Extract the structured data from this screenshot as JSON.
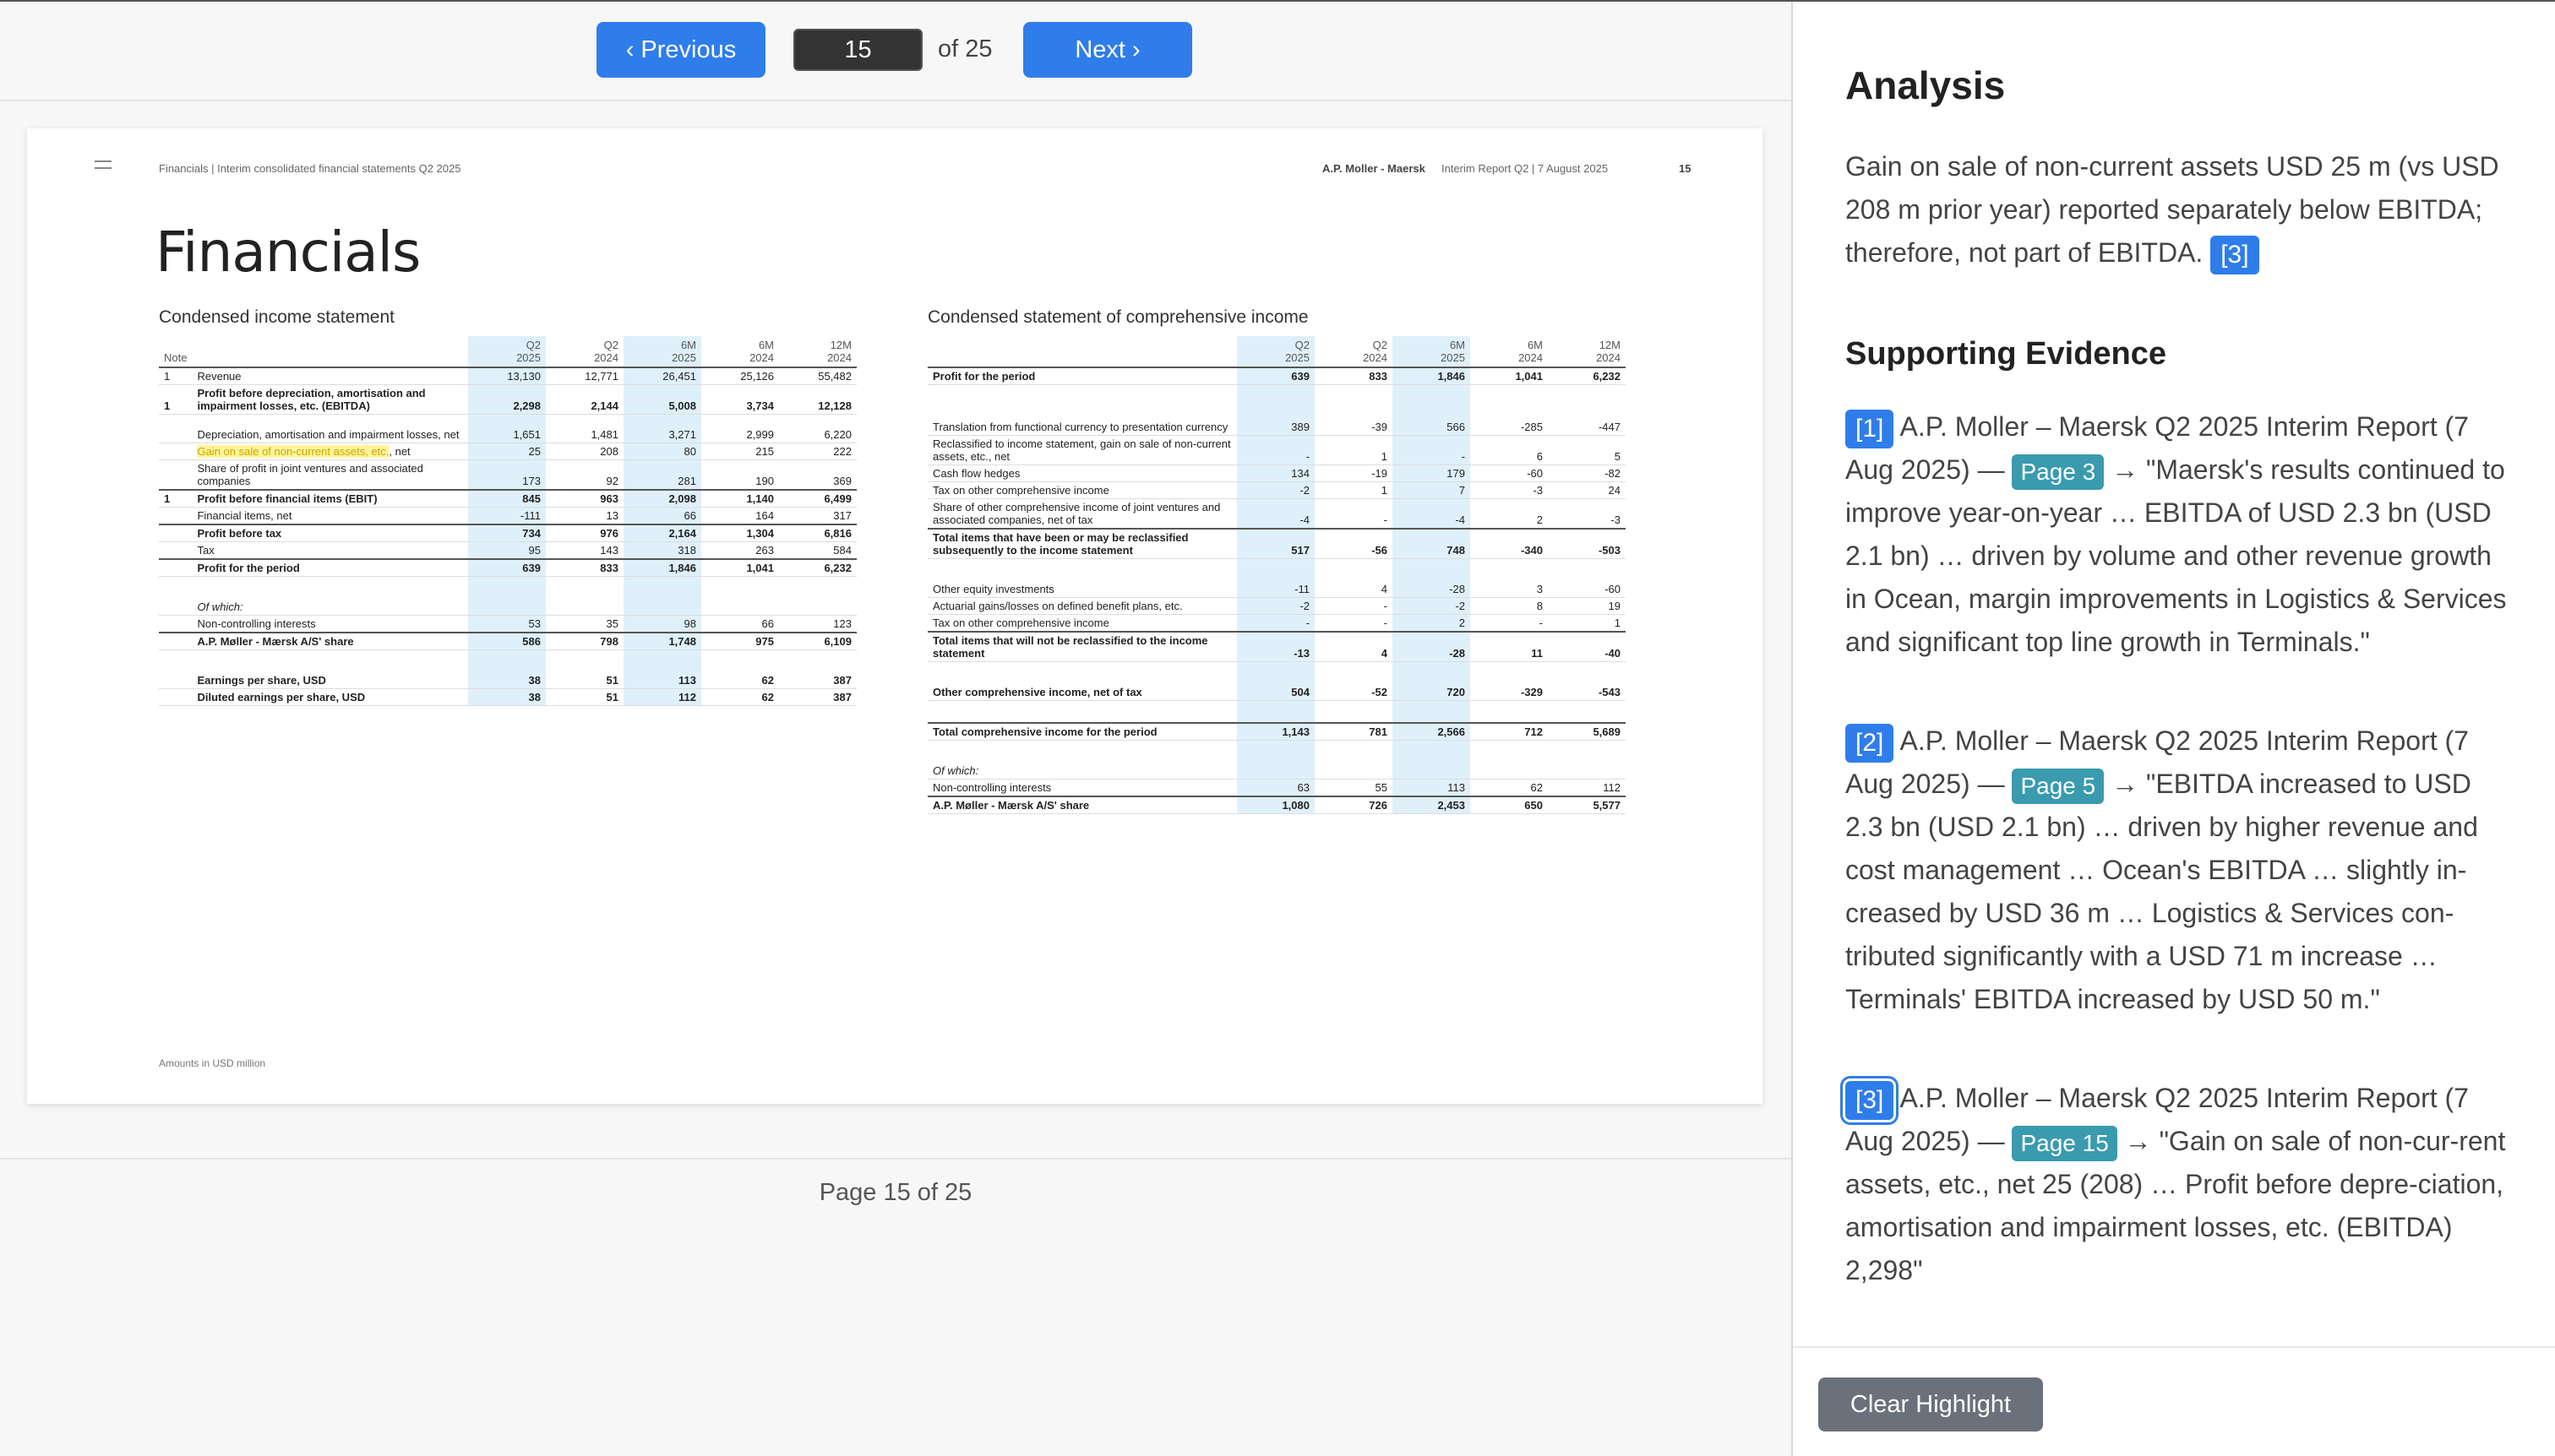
{
  "toolbar": {
    "prev_label": "‹ Previous",
    "next_label": "Next ›",
    "page_value": "15",
    "page_total": "of 25"
  },
  "page_indicator": "Page 15 of 25",
  "document": {
    "header_left": "Financials   |   Interim consolidated financial statements Q2 2025",
    "header_company": "A.P. Moller - Maersk",
    "header_report": "Interim Report Q2  |  7 August 2025",
    "header_page": "15",
    "title": "Financials",
    "footer_note": "Amounts in USD million",
    "income": {
      "title": "Condensed income statement",
      "note_header": "Note",
      "columns": [
        {
          "period": "Q2",
          "year": "2025",
          "highlight": true
        },
        {
          "period": "Q2",
          "year": "2024",
          "highlight": false
        },
        {
          "period": "6M",
          "year": "2025",
          "highlight": true
        },
        {
          "period": "6M",
          "year": "2024",
          "highlight": false
        },
        {
          "period": "12M",
          "year": "2024",
          "highlight": false
        }
      ],
      "rows": [
        {
          "note": "1",
          "label": "Revenue",
          "values": [
            "13,130",
            "12,771",
            "26,451",
            "25,126",
            "55,482"
          ],
          "style": ""
        },
        {
          "note": "1",
          "label": "Profit before depreciation, amortisation and impairment losses, etc. (EBITDA)",
          "values": [
            "2,298",
            "2,144",
            "5,008",
            "3,734",
            "12,128"
          ],
          "style": "bold tall"
        },
        {
          "note": "",
          "label": "Depreciation, amortisation and impairment losses, net",
          "values": [
            "1,651",
            "1,481",
            "3,271",
            "2,999",
            "6,220"
          ],
          "style": "tall"
        },
        {
          "note": "",
          "label": "Gain on sale of non-current assets, etc.",
          "label_suffix": ", net",
          "values": [
            "25",
            "208",
            "80",
            "215",
            "222"
          ],
          "style": "mark"
        },
        {
          "note": "",
          "label": "Share of profit in joint ventures and associated companies",
          "values": [
            "173",
            "92",
            "281",
            "190",
            "369"
          ],
          "style": "tall"
        },
        {
          "note": "1",
          "label": "Profit before financial items (EBIT)",
          "values": [
            "845",
            "963",
            "2,098",
            "1,140",
            "6,499"
          ],
          "style": "bold topline"
        },
        {
          "note": "",
          "label": "Financial items, net",
          "values": [
            "-111",
            "13",
            "66",
            "164",
            "317"
          ],
          "style": ""
        },
        {
          "note": "",
          "label": "Profit before tax",
          "values": [
            "734",
            "976",
            "2,164",
            "1,304",
            "6,816"
          ],
          "style": "bold topline"
        },
        {
          "note": "",
          "label": "Tax",
          "values": [
            "95",
            "143",
            "318",
            "263",
            "584"
          ],
          "style": ""
        },
        {
          "note": "",
          "label": "Profit for the period",
          "values": [
            "639",
            "833",
            "1,846",
            "1,041",
            "6,232"
          ],
          "style": "bold topline"
        },
        {
          "note": "",
          "label": "",
          "values": [
            "",
            "",
            "",
            "",
            ""
          ],
          "style": "gap"
        },
        {
          "note": "",
          "label": "Of which:",
          "values": [
            "",
            "",
            "",
            "",
            ""
          ],
          "style": "italic"
        },
        {
          "note": "",
          "label": "Non-controlling interests",
          "values": [
            "53",
            "35",
            "98",
            "66",
            "123"
          ],
          "style": ""
        },
        {
          "note": "",
          "label": "A.P. Møller - Mærsk A/S' share",
          "values": [
            "586",
            "798",
            "1,748",
            "975",
            "6,109"
          ],
          "style": "bold topline"
        },
        {
          "note": "",
          "label": "",
          "values": [
            "",
            "",
            "",
            "",
            ""
          ],
          "style": "gap"
        },
        {
          "note": "",
          "label": "Earnings per share, USD",
          "values": [
            "38",
            "51",
            "113",
            "62",
            "387"
          ],
          "style": "bold"
        },
        {
          "note": "",
          "label": "Diluted earnings per share, USD",
          "values": [
            "38",
            "51",
            "112",
            "62",
            "387"
          ],
          "style": "bold"
        }
      ]
    },
    "comprehensive": {
      "title": "Condensed statement of comprehensive income",
      "columns": [
        {
          "period": "Q2",
          "year": "2025",
          "highlight": true
        },
        {
          "period": "Q2",
          "year": "2024",
          "highlight": false
        },
        {
          "period": "6M",
          "year": "2025",
          "highlight": true
        },
        {
          "period": "6M",
          "year": "2024",
          "highlight": false
        },
        {
          "period": "12M",
          "year": "2024",
          "highlight": false
        }
      ],
      "rows": [
        {
          "label": "Profit for the period",
          "values": [
            "639",
            "833",
            "1,846",
            "1,041",
            "6,232"
          ],
          "style": "bold"
        },
        {
          "label": "",
          "values": [
            "",
            "",
            "",
            "",
            ""
          ],
          "style": "gap"
        },
        {
          "label": "Translation from functional currency to presentation currency",
          "values": [
            "389",
            "-39",
            "566",
            "-285",
            "-447"
          ],
          "style": "tall"
        },
        {
          "label": "Reclassified to income statement, gain on sale of non-current assets, etc., net",
          "values": [
            "-",
            "1",
            "-",
            "6",
            "5"
          ],
          "style": "tall"
        },
        {
          "label": "Cash flow hedges",
          "values": [
            "134",
            "-19",
            "179",
            "-60",
            "-82"
          ],
          "style": ""
        },
        {
          "label": "Tax on other comprehensive income",
          "values": [
            "-2",
            "1",
            "7",
            "-3",
            "24"
          ],
          "style": ""
        },
        {
          "label": "Share of other comprehensive income of joint ventures and associated companies, net of tax",
          "values": [
            "-4",
            "-",
            "-4",
            "2",
            "-3"
          ],
          "style": "tall"
        },
        {
          "label": "Total items that have been or may be reclassified subsequently to the income statement",
          "values": [
            "517",
            "-56",
            "748",
            "-340",
            "-503"
          ],
          "style": "bold tall topline"
        },
        {
          "label": "",
          "values": [
            "",
            "",
            "",
            "",
            ""
          ],
          "style": "gap"
        },
        {
          "label": "Other equity investments",
          "values": [
            "-11",
            "4",
            "-28",
            "3",
            "-60"
          ],
          "style": ""
        },
        {
          "label": "Actuarial gains/losses on defined benefit plans, etc.",
          "values": [
            "-2",
            "-",
            "-2",
            "8",
            "19"
          ],
          "style": ""
        },
        {
          "label": "Tax on other comprehensive income",
          "values": [
            "-",
            "-",
            "2",
            "-",
            "1"
          ],
          "style": ""
        },
        {
          "label": "Total items that will not be reclassified to the income statement",
          "values": [
            "-13",
            "4",
            "-28",
            "11",
            "-40"
          ],
          "style": "bold tall topline"
        },
        {
          "label": "",
          "values": [
            "",
            "",
            "",
            "",
            ""
          ],
          "style": "gap"
        },
        {
          "label": "Other comprehensive income, net of tax",
          "values": [
            "504",
            "-52",
            "720",
            "-329",
            "-543"
          ],
          "style": "bold"
        },
        {
          "label": "",
          "values": [
            "",
            "",
            "",
            "",
            ""
          ],
          "style": "gap"
        },
        {
          "label": "Total comprehensive income for the period",
          "values": [
            "1,143",
            "781",
            "2,566",
            "712",
            "5,689"
          ],
          "style": "bold topline"
        },
        {
          "label": "",
          "values": [
            "",
            "",
            "",
            "",
            ""
          ],
          "style": "gap"
        },
        {
          "label": "Of which:",
          "values": [
            "",
            "",
            "",
            "",
            ""
          ],
          "style": "italic"
        },
        {
          "label": "Non-controlling interests",
          "values": [
            "63",
            "55",
            "113",
            "62",
            "112"
          ],
          "style": ""
        },
        {
          "label": "A.P. Møller - Mærsk A/S' share",
          "values": [
            "1,080",
            "726",
            "2,453",
            "650",
            "5,577"
          ],
          "style": "bold topline"
        }
      ]
    }
  },
  "panel": {
    "analysis_title": "Analysis",
    "analysis_text": "Gain on sale of non-current assets USD 25 m (vs USD 208 m prior year) reported separately below EBITDA; therefore, not part of EBITDA.",
    "analysis_cite": "[3]",
    "evidence_title": "Supporting Evidence",
    "evidence": [
      {
        "cite": "[1]",
        "source": "A.P. Moller – Maersk Q2 2025 Interim Report (7 Aug 2025) —",
        "page": "Page 3",
        "arrow": "→",
        "quote": "\"Maersk's results continued to improve year-on-year … EBITDA of USD 2.3 bn (USD 2.1 bn) … driven by volume and other revenue growth in Ocean, margin improvements in Logistics & Services and significant top line growth in Terminals.\""
      },
      {
        "cite": "[2]",
        "source": "A.P. Moller – Maersk Q2 2025 Interim Report (7 Aug 2025) —",
        "page": "Page 5",
        "arrow": "→",
        "quote": "\"EBITDA increased to USD 2.3 bn (USD 2.1 bn) … driven by higher revenue and cost management … Ocean's EBITDA … slightly in-creased by USD 36 m … Logistics & Services con-tributed significantly with a USD 71 m increase … Terminals' EBITDA increased by USD 50 m.\""
      },
      {
        "cite": "[3]",
        "source": "A.P. Moller – Maersk Q2 2025 Interim Report (7 Aug 2025) —",
        "page": "Page 15",
        "arrow": "→",
        "quote": "\"Gain on sale of non-cur-rent assets, etc., net 25 (208) … Profit before depre-ciation, amortisation and impairment losses, etc. (EBITDA) 2,298\""
      }
    ],
    "clear_label": "Clear Highlight"
  },
  "colors": {
    "accent": "#2f7dea",
    "page_badge": "#3a9aae",
    "clear_button": "#6b717a",
    "column_highlight": "#dff0fb",
    "text_highlight": "#fff59a"
  }
}
